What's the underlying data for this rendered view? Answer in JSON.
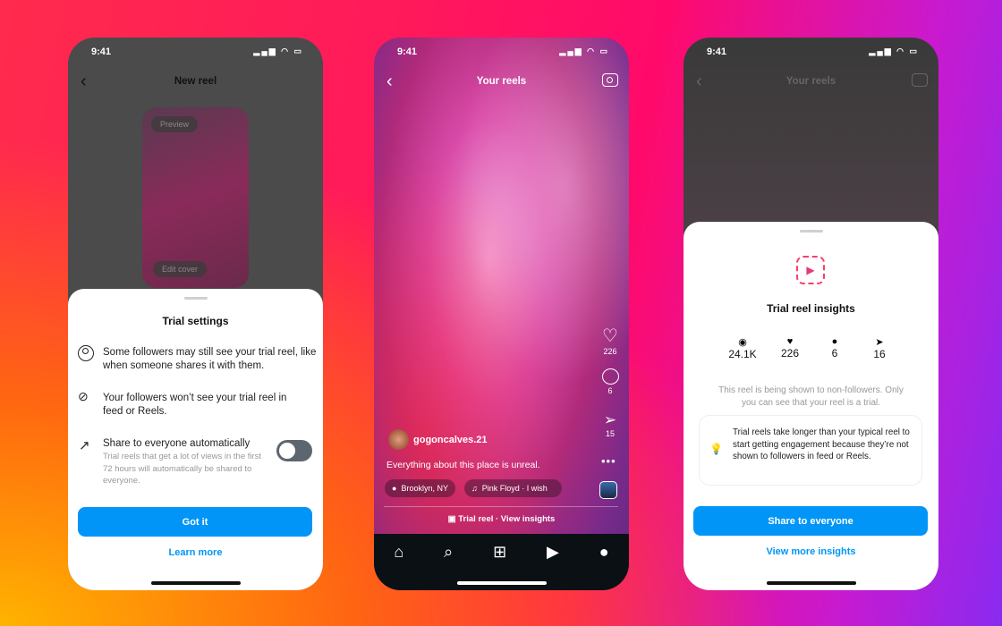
{
  "status_time": "9:41",
  "phone1": {
    "header_title": "New reel",
    "preview_label": "Preview",
    "edit_cover_label": "Edit cover",
    "sheet_title": "Trial settings",
    "items": [
      {
        "icon": "person-circle-icon",
        "text": "Some followers may still see your trial reel, like when someone shares it with them."
      },
      {
        "icon": "eye-off-icon",
        "text": "Your followers won’t see your trial reel in feed or Reels."
      }
    ],
    "toggle_item": {
      "icon": "arrow-up-right-icon",
      "title": "Share to everyone automatically",
      "subtitle": "Trial reels that get a lot of views in the first 72 hours will automatically be shared to everyone.",
      "toggle_on": false
    },
    "primary_button": "Got it",
    "link": "Learn more"
  },
  "phone2": {
    "header_title": "Your reels",
    "likes": "226",
    "comments": "6",
    "shares": "15",
    "username": "gogoncalves.21",
    "caption": "Everything about this place is unreal.",
    "location": "Brooklyn, NY",
    "music": "Pink Floyd · I wish",
    "trial_bar": "Trial reel · View insights",
    "nav": [
      "home-icon",
      "search-icon",
      "create-icon",
      "reels-icon",
      "profile-icon"
    ]
  },
  "phone3": {
    "header_title": "Your reels",
    "sheet_title": "Trial reel insights",
    "stats": [
      {
        "icon": "eye-icon",
        "value": "24.1K"
      },
      {
        "icon": "heart-icon",
        "value": "226"
      },
      {
        "icon": "comment-icon",
        "value": "6"
      },
      {
        "icon": "share-icon",
        "value": "16"
      }
    ],
    "note": "This reel is being shown to non-followers. Only you can see that your reel is a trial.",
    "tip": "Trial reels take longer than your typical reel to start getting engagement because they’re not shown to followers in feed or Reels.",
    "primary_button": "Share to everyone",
    "link": "View more insights"
  },
  "colors": {
    "accent": "#0095f6"
  }
}
